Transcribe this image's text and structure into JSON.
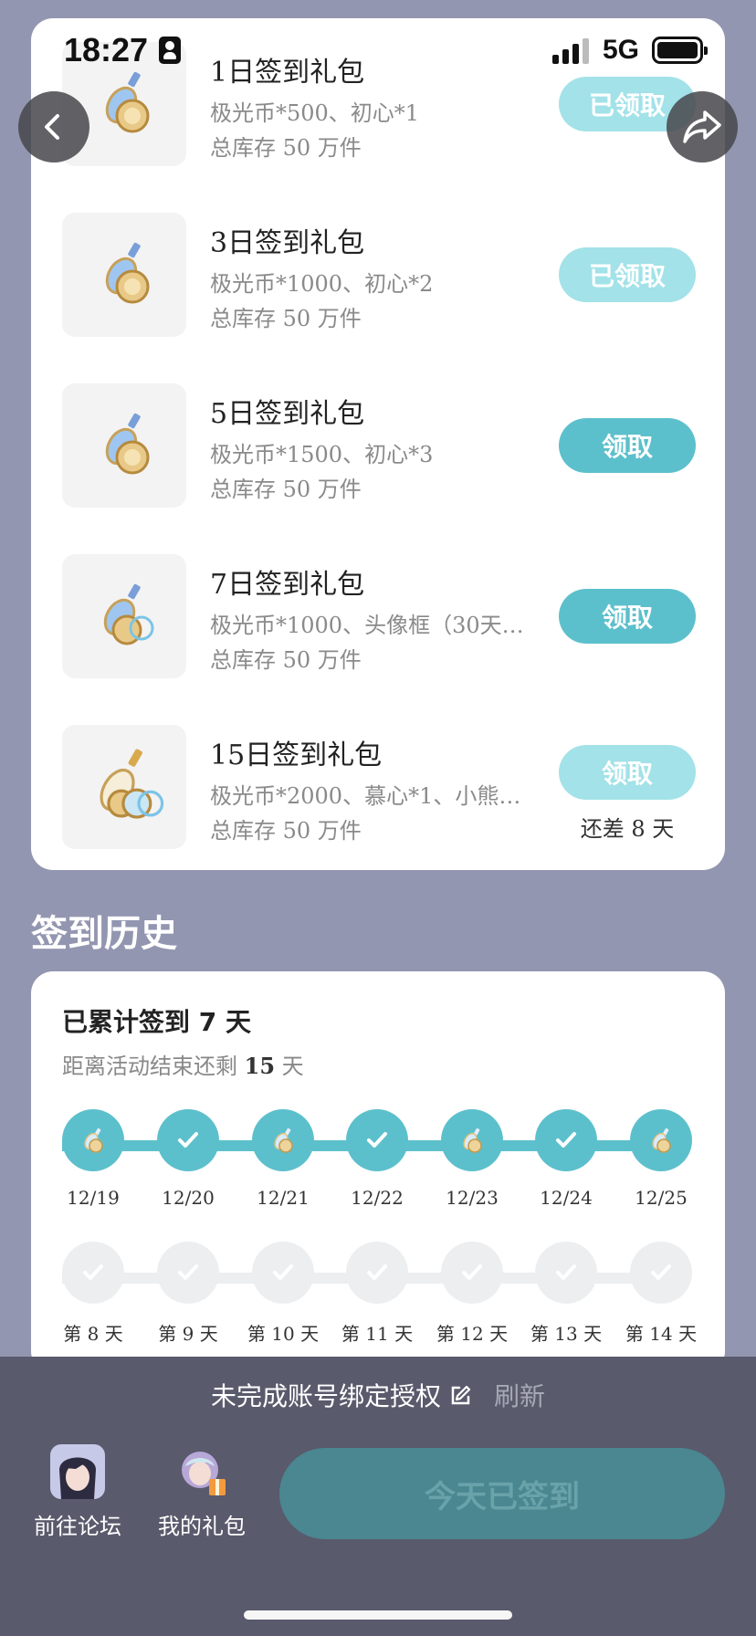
{
  "status_bar": {
    "time": "18:27",
    "network": "5G"
  },
  "gifts": [
    {
      "title": "1日签到礼包",
      "desc": "极光币*500、初心*1",
      "stock": "总库存 50 万件",
      "button": "已领取",
      "state": "claimed",
      "remain": ""
    },
    {
      "title": "3日签到礼包",
      "desc": "极光币*1000、初心*2",
      "stock": "总库存 50 万件",
      "button": "已领取",
      "state": "claimed",
      "remain": ""
    },
    {
      "title": "5日签到礼包",
      "desc": "极光币*1500、初心*3",
      "stock": "总库存 50 万件",
      "button": "领取",
      "state": "available",
      "remain": ""
    },
    {
      "title": "7日签到礼包",
      "desc": "极光币*1000、头像框（30天…",
      "stock": "总库存 50 万件",
      "button": "领取",
      "state": "available",
      "remain": ""
    },
    {
      "title": "15日签到礼包",
      "desc": "极光币*2000、慕心*1、小熊…",
      "stock": "总库存 50 万件",
      "button": "领取",
      "state": "locked",
      "remain": "还差 8 天"
    }
  ],
  "history": {
    "section_title": "签到历史",
    "title": "已累计签到 7 天",
    "subtitle_prefix": "距离活动结束还剩 ",
    "days_left": "15",
    "subtitle_suffix": " 天",
    "done_days": [
      {
        "label": "12/19",
        "icon": "bottle-icon"
      },
      {
        "label": "12/20",
        "icon": "check-icon"
      },
      {
        "label": "12/21",
        "icon": "bottle-icon"
      },
      {
        "label": "12/22",
        "icon": "check-icon"
      },
      {
        "label": "12/23",
        "icon": "bottle-icon"
      },
      {
        "label": "12/24",
        "icon": "check-icon"
      },
      {
        "label": "12/25",
        "icon": "bottle-icon"
      }
    ],
    "future_days": [
      "第 8 天",
      "第 9 天",
      "第 10 天",
      "第 11 天",
      "第 12 天",
      "第 13 天",
      "第 14 天"
    ]
  },
  "bottom": {
    "bind_text": "未完成账号绑定授权",
    "refresh": "刷新",
    "forum": "前往论坛",
    "my_gifts": "我的礼包",
    "signed_button": "今天已签到"
  },
  "colors": {
    "accent": "#5cc0cc",
    "accent_light": "#a2e2e8",
    "background": "#9396b0",
    "bottom_bar": "#595a6c"
  }
}
